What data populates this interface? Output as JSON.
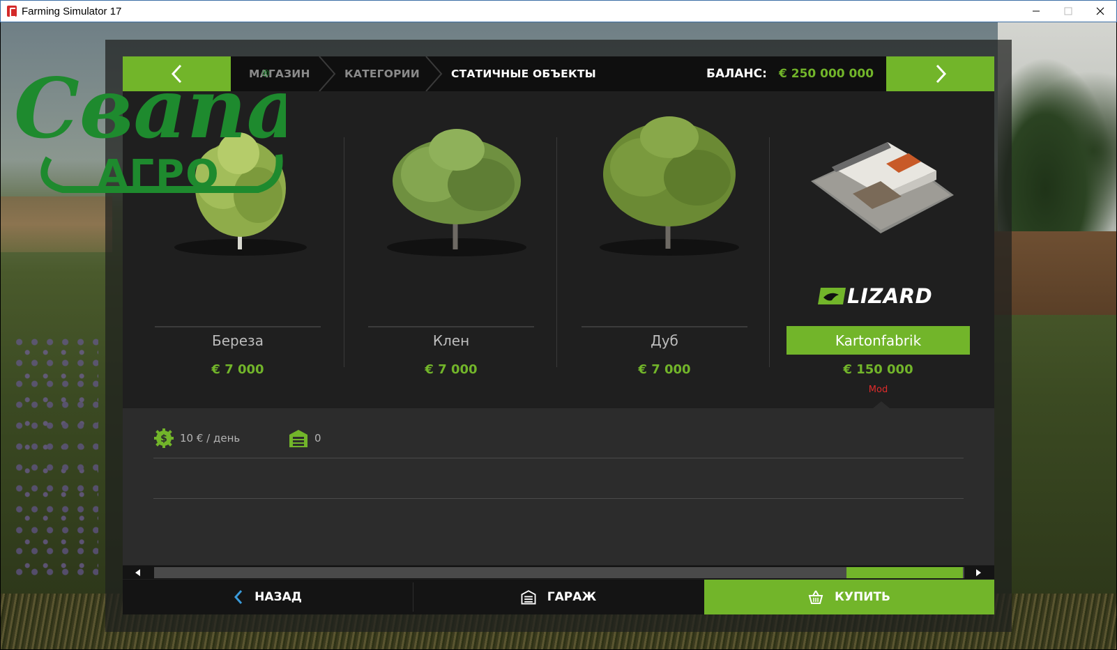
{
  "window": {
    "title": "Farming Simulator 17",
    "minimize": "—",
    "maximize": "☐",
    "close": "✕"
  },
  "logo": {
    "script": "Свапа",
    "sub": "АГРО",
    "mark": "®",
    "color": "#1e8a2e"
  },
  "breadcrumb": {
    "shop": "МАГАЗИН",
    "categories": "КАТЕГОРИИ",
    "current": "СТАТИЧНЫЕ ОБЪЕКТЫ"
  },
  "balance": {
    "label": "БАЛАНС:",
    "value": "€ 250 000 000"
  },
  "items": [
    {
      "name": "Береза",
      "price": "€ 7 000",
      "icon": "birch-tree-icon"
    },
    {
      "name": "Клен",
      "price": "€ 7 000",
      "icon": "maple-tree-icon"
    },
    {
      "name": "Дуб",
      "price": "€ 7 000",
      "icon": "oak-tree-icon"
    },
    {
      "name": "Kartonfabrik",
      "price": "€ 150 000",
      "brand": "LIZARD",
      "tag": "Mod",
      "icon": "factory-building-icon"
    }
  ],
  "details": {
    "upkeep": "10 € / день",
    "owned": "0"
  },
  "bottom": {
    "back": "НАЗАД",
    "garage": "ГАРАЖ",
    "buy": "КУПИТЬ"
  },
  "scroll": {
    "position": 0.9
  },
  "colors": {
    "accent": "#72b52a",
    "panel": "#1f1f1f",
    "mod": "#e02b2b"
  }
}
